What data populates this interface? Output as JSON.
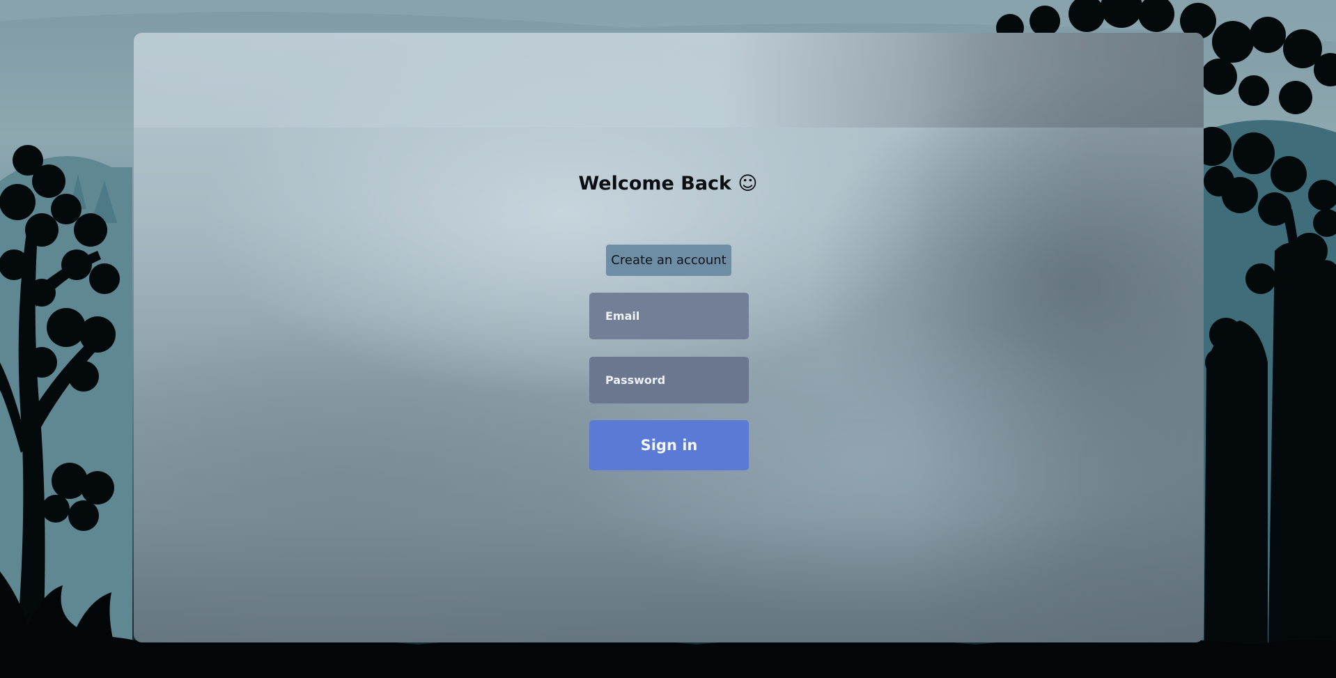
{
  "login": {
    "title": "Welcome Back ☺",
    "create_account_label": "Create an account",
    "email_placeholder": "Email",
    "password_placeholder": "Password",
    "signin_label": "Sign in"
  },
  "colors": {
    "signin_button": "#5b7ad6",
    "create_button": "#6e8ea6",
    "input_background": "#717e95"
  }
}
